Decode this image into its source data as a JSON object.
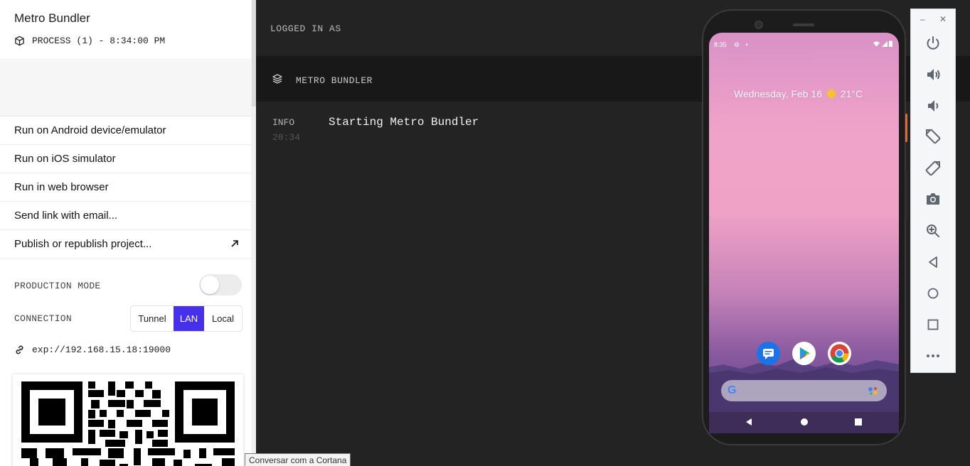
{
  "sidebar": {
    "title": "Metro Bundler",
    "process_text": "PROCESS (1) - 8:34:00 PM",
    "menu": [
      {
        "label": "Run on Android device/emulator"
      },
      {
        "label": "Run on iOS simulator"
      },
      {
        "label": "Run in web browser"
      },
      {
        "label": "Send link with email..."
      },
      {
        "label": "Publish or republish project..."
      }
    ],
    "production_mode_label": "PRODUCTION MODE",
    "production_mode_enabled": false,
    "connection_label": "CONNECTION",
    "connection_options": [
      "Tunnel",
      "LAN",
      "Local"
    ],
    "connection_selected": "LAN",
    "url": "exp://192.168.15.18:19000"
  },
  "main": {
    "logged_in_label": "LOGGED IN AS",
    "section_title": "METRO BUNDLER",
    "log": {
      "level": "INFO",
      "time": "20:34",
      "message": "Starting Metro Bundler"
    }
  },
  "phone": {
    "status_time": "8:35",
    "date_weather": "Wednesday, Feb 16 ",
    "temperature": "21°C",
    "apps": [
      "messages-icon",
      "play-store-icon",
      "chrome-icon"
    ]
  },
  "emulator_toolbar": {
    "buttons": [
      "power-icon",
      "volume-up-icon",
      "volume-down-icon",
      "rotate-left-icon",
      "rotate-right-icon",
      "camera-icon",
      "zoom-icon",
      "back-icon",
      "home-icon",
      "overview-icon",
      "more-icon"
    ]
  },
  "tooltip": "Conversar com a Cortana",
  "colors": {
    "accent": "#4630eb",
    "log_bg": "#232323",
    "header_bg": "#181818"
  }
}
